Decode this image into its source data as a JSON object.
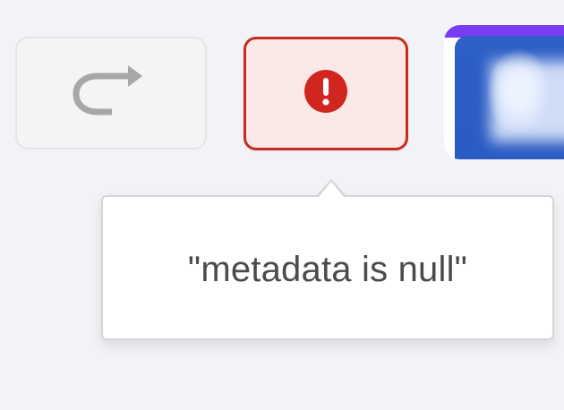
{
  "toolbar": {
    "redo_icon": "redo-arrow-icon",
    "error_icon": "exclamation-circle-icon"
  },
  "tooltip": {
    "text": "\"metadata is null\""
  },
  "colors": {
    "background": "#f2f3f6",
    "error_border": "#c72c23",
    "error_fill": "#fbe9e8",
    "error_icon": "#d1261f",
    "thumbnail_blue": "#2d5fc6",
    "thumbnail_accent": "#7a3cf0"
  }
}
